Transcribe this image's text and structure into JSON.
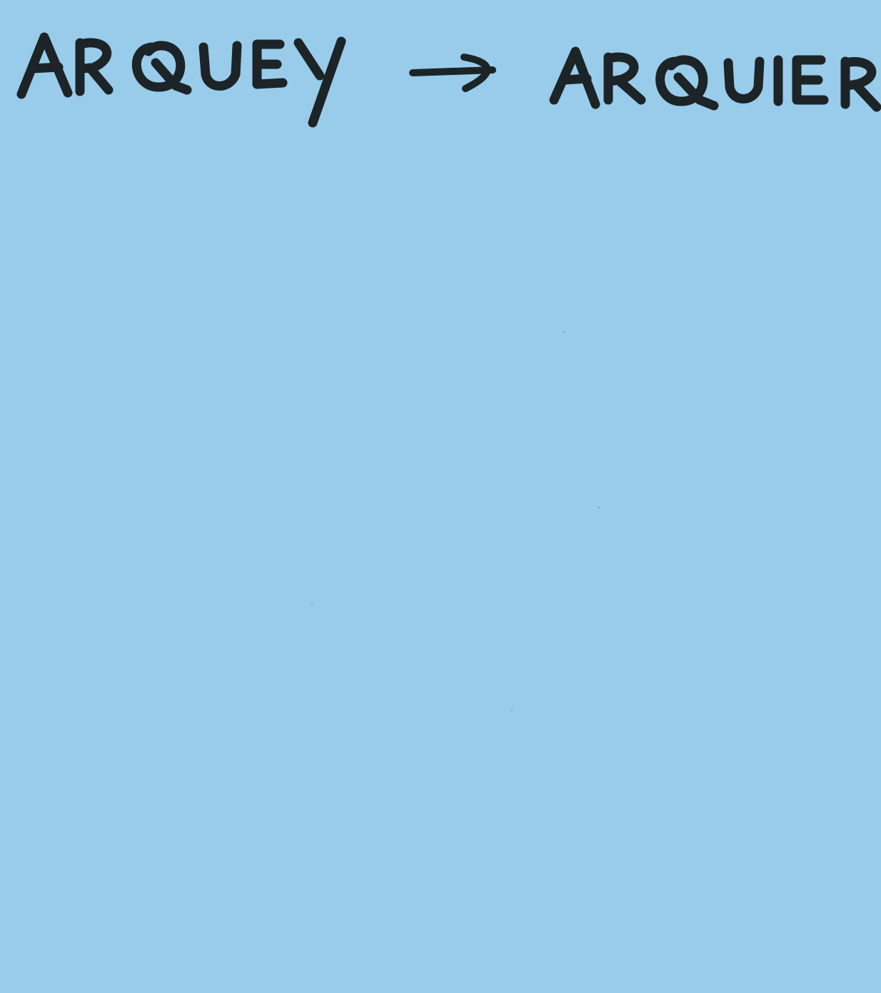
{
  "note": {
    "background_color": "#99cceb",
    "ink_color": "#1c2428",
    "words": {
      "source": "ARQUEY",
      "target": "ARQUIER"
    },
    "arrow_icon": "right-arrow-icon"
  }
}
